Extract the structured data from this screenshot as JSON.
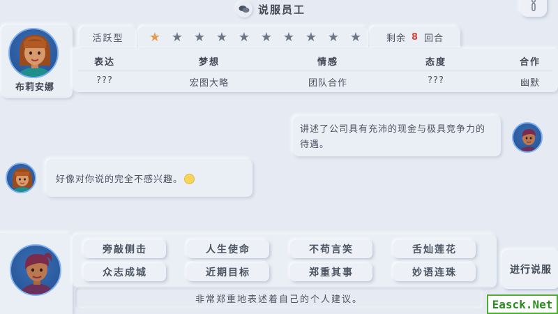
{
  "header": {
    "title": "说服员工",
    "title_icon": "chat-bubbles-icon",
    "info_icon": "info-icon"
  },
  "npc": {
    "name": "布莉安娜",
    "personality": "活跃型",
    "rating": {
      "filled": 1,
      "total": 10
    },
    "rounds": {
      "prefix": "剩余",
      "count": "8",
      "suffix": "回合"
    },
    "attributes": [
      {
        "label": "表达",
        "value": "???"
      },
      {
        "label": "梦想",
        "value": "宏图大略"
      },
      {
        "label": "情感",
        "value": "团队合作"
      },
      {
        "label": "态度",
        "value": "???"
      },
      {
        "label": "合作",
        "value": "幽默"
      }
    ]
  },
  "chat": {
    "player_message": "讲述了公司具有充沛的现金与极具竞争力的待遇。",
    "npc_message": "好像对你说的完全不感兴趣。"
  },
  "skills": {
    "options": [
      [
        "旁敲侧击",
        "人生使命",
        "不苟言笑",
        "舌灿莲花"
      ],
      [
        "众志成城",
        "近期目标",
        "郑重其事",
        "妙语连珠"
      ]
    ],
    "description": "非常郑重地表述着自己的个人建议。",
    "go_label": "进行说服"
  },
  "watermark": "Easck.Net",
  "colors": {
    "accent_star": "#e79a4c",
    "rounds_count": "#d9453c",
    "background": "#e6ebf3"
  }
}
